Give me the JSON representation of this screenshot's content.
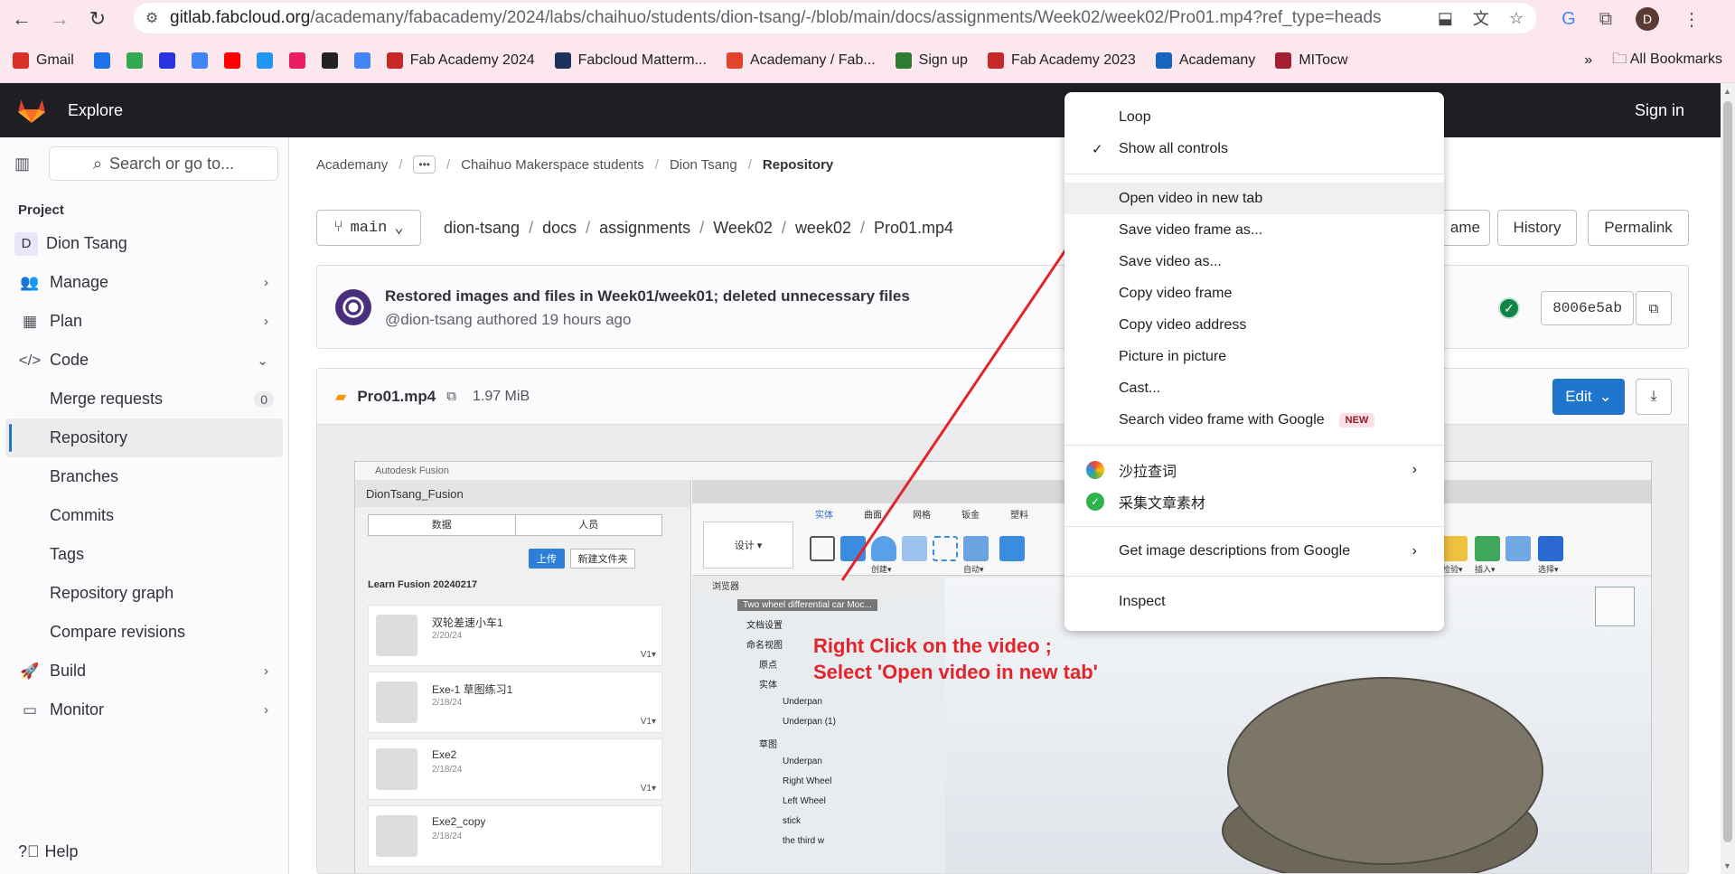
{
  "browser": {
    "url_host": "gitlab.fabcloud.org",
    "url_rest": "/academany/fabacademy/2024/labs/chaihuo/students/dion-tsang/-/blob/main/docs/assignments/Week02/week02/Pro01.mp4?ref_type=heads",
    "profile_initial": "D",
    "bookmarks": [
      {
        "label": "Gmail",
        "icon": "gmail-icon",
        "color": "#d93025"
      },
      {
        "label": "",
        "icon": "calendar-icon",
        "color": "#1a73e8"
      },
      {
        "label": "",
        "icon": "maps-icon",
        "color": "#34a853"
      },
      {
        "label": "",
        "icon": "baidu-icon",
        "color": "#2932e1"
      },
      {
        "label": "",
        "icon": "google-icon",
        "color": "#4285f4"
      },
      {
        "label": "",
        "icon": "youtube-icon",
        "color": "#ff0000"
      },
      {
        "label": "",
        "icon": "translate-icon",
        "color": "#2196f3"
      },
      {
        "label": "",
        "icon": "yahoo-icon",
        "color": "#e91e63"
      },
      {
        "label": "",
        "icon": "cube-icon",
        "color": "#222222"
      },
      {
        "label": "",
        "icon": "google-translate-icon",
        "color": "#4285f4"
      },
      {
        "label": "Fab Academy 2024",
        "icon": "fab-academy-icon",
        "color": "#c62828"
      },
      {
        "label": "Fabcloud Matterm...",
        "icon": "mattermost-icon",
        "color": "#1e325c"
      },
      {
        "label": "Academany / Fab...",
        "icon": "gitlab-icon",
        "color": "#e24329"
      },
      {
        "label": "Sign up",
        "icon": "signup-icon",
        "color": "#2e7d32"
      },
      {
        "label": "Fab Academy 2023",
        "icon": "fab-academy-icon",
        "color": "#c62828"
      },
      {
        "label": "Academany",
        "icon": "academany-icon",
        "color": "#1565c0"
      },
      {
        "label": "MITocw",
        "icon": "mit-icon",
        "color": "#a31f34"
      }
    ],
    "more_bookmarks": "»",
    "all_bookmarks": "All Bookmarks"
  },
  "gitlab": {
    "explore": "Explore",
    "sign_in": "Sign in",
    "search_placeholder": "Search or go to...",
    "project_heading": "Project",
    "project_initial": "D",
    "project_name": "Dion Tsang",
    "nav": {
      "manage": "Manage",
      "plan": "Plan",
      "code": "Code",
      "merge_requests": "Merge requests",
      "merge_requests_count": "0",
      "repository": "Repository",
      "branches": "Branches",
      "commits": "Commits",
      "tags": "Tags",
      "repository_graph": "Repository graph",
      "compare_revisions": "Compare revisions",
      "build": "Build",
      "monitor": "Monitor"
    },
    "help": "Help",
    "breadcrumb": [
      "Academany",
      "Chaihuo Makerspace students",
      "Dion Tsang",
      "Repository"
    ],
    "breadcrumb_more": "•••",
    "branch": "main",
    "path": [
      "dion-tsang",
      "docs",
      "assignments",
      "Week02",
      "week02",
      "Pro01.mp4"
    ],
    "buttons": {
      "blame": "ame",
      "history": "History",
      "permalink": "Permalink",
      "edit": "Edit"
    },
    "commit": {
      "title": "Restored images and files in Week01/week01; deleted unnecessary files",
      "author_line": "@dion-tsang authored 19 hours ago",
      "sha": "8006e5ab"
    },
    "file": {
      "name": "Pro01.mp4",
      "size": "1.97 MiB"
    }
  },
  "video": {
    "app_title": "Autodesk Fusion",
    "project": "DionTsang_Fusion",
    "tabs": [
      "数据",
      "人员"
    ],
    "upload": "上传",
    "new_folder": "新建文件夹",
    "crumb": "Learn Fusion 20240217",
    "cards": [
      {
        "name": "双轮差速小车1",
        "date": "2/20/24",
        "ver": "V1▾"
      },
      {
        "name": "Exe-1 草图练习1",
        "date": "2/18/24",
        "ver": "V1▾"
      },
      {
        "name": "Exe2",
        "date": "2/18/24",
        "ver": "V1▾"
      },
      {
        "name": "Exe2_copy",
        "date": "2/18/24",
        "ver": ""
      }
    ],
    "design_btn": "设计 ▾",
    "ribbon_tabs": [
      "实体",
      "曲面",
      "网格",
      "钣金",
      "塑料"
    ],
    "ribbon_labels": [
      "创建▾",
      "自动▾",
      "检验▾",
      "插入▾",
      "选择▾"
    ],
    "browser_label": "浏览器",
    "doc_name": "Two wheel differential car Moc...",
    "tree": [
      "文档设置",
      "命名视图",
      "原点",
      "实体",
      "Underpan",
      "Underpan (1)",
      "草图",
      "Underpan",
      "Right Wheel",
      "Left Wheel",
      "stick",
      "the third w"
    ],
    "annotation_line1": "Right Click on the video ;",
    "annotation_line2": "Select 'Open video in new tab'"
  },
  "context_menu": {
    "loop": "Loop",
    "show_all_controls": "Show all controls",
    "open_new_tab": "Open video in new tab",
    "save_frame": "Save video frame as...",
    "save_video": "Save video as...",
    "copy_frame": "Copy video frame",
    "copy_address": "Copy video address",
    "pip": "Picture in picture",
    "cast": "Cast...",
    "search_frame": "Search video frame with Google",
    "new_badge": "NEW",
    "salad": "沙拉查词",
    "collect": "采集文章素材",
    "image_desc": "Get image descriptions from Google",
    "inspect": "Inspect"
  }
}
